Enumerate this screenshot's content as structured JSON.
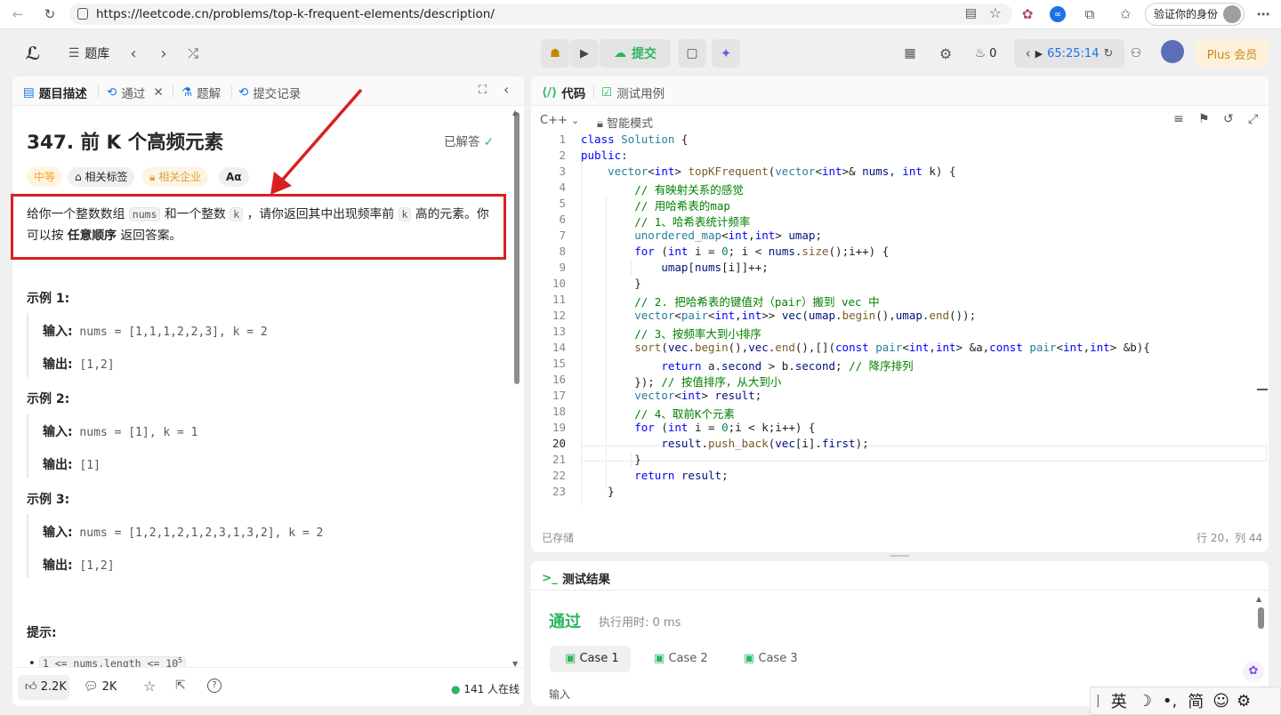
{
  "browser": {
    "url": "https://leetcode.cn/problems/top-k-frequent-elements/description/",
    "profile_label": "验证你的身份"
  },
  "appbar": {
    "problem_list_label": "题库",
    "submit_label": "提交",
    "fire_count": "0",
    "timer": "65:25:14",
    "plus_label": "Plus 会员"
  },
  "left_tabs": {
    "description": "题目描述",
    "accepted": "通过",
    "solutions": "题解",
    "submissions": "提交记录"
  },
  "problem": {
    "title": "347. 前 K 个高频元素",
    "solved_label": "已解答",
    "tags": {
      "difficulty": "中等",
      "related_tags": "相关标签",
      "companies": "相关企业",
      "lang": "Aα"
    },
    "desc_part1": "给你一个整数数组 ",
    "desc_code1": "nums",
    "desc_part2": " 和一个整数 ",
    "desc_code2": "k",
    "desc_part3": " ，请你返回其中出现频率前 ",
    "desc_code3": "k",
    "desc_part4": " 高的元素。你可以按 ",
    "desc_bold": "任意顺序",
    "desc_part5": " 返回答案。",
    "examples": [
      {
        "heading": "示例 1:",
        "input_label": "输入:",
        "input": " nums = [1,1,1,2,2,3], k = 2",
        "output_label": "输出:",
        "output": " [1,2]"
      },
      {
        "heading": "示例 2:",
        "input_label": "输入:",
        "input": " nums = [1], k = 1",
        "output_label": "输出:",
        "output": " [1]"
      },
      {
        "heading": "示例 3:",
        "input_label": "输入:",
        "input": " nums = [1,2,1,2,1,2,3,1,3,2], k = 2",
        "output_label": "输出:",
        "output": " [1,2]"
      }
    ],
    "hints_heading": "提示:",
    "constraint": "1 <= nums.length <= 10",
    "constraint_sup": "5"
  },
  "left_footer": {
    "likes": "2.2K",
    "comments": "2K",
    "online": "141 人在线"
  },
  "code_panel": {
    "tab_code": "代码",
    "tab_testcase": "测试用例",
    "language": "C++",
    "mode": "智能模式",
    "saved": "已存储",
    "cursor": "行 20，列 44",
    "lines": [
      "class Solution {",
      "public:",
      "    vector<int> topKFrequent(vector<int>& nums, int k) {",
      "        // 有映射关系的感觉",
      "        // 用哈希表的map",
      "        // 1、哈希表统计频率",
      "        unordered_map<int,int> umap;",
      "        for (int i = 0; i < nums.size();i++) {",
      "            umap[nums[i]]++;",
      "        }",
      "        // 2. 把哈希表的键值对（pair）搬到 vec 中",
      "        vector<pair<int,int>> vec(umap.begin(),umap.end());",
      "        // 3、按频率大到小排序",
      "        sort(vec.begin(),vec.end(),[](const pair<int,int> &a,const pair<int,int> &b){",
      "            return a.second > b.second; // 降序排列",
      "        }); // 按值排序，从大到小",
      "        vector<int> result;",
      "        // 4、取前K个元素",
      "        for (int i = 0;i < k;i++) {",
      "            result.push_back(vec[i].first);",
      "        }",
      "        return result;",
      "    }"
    ]
  },
  "result_panel": {
    "title": "测试结果",
    "status": "通过",
    "runtime": "执行用时: 0 ms",
    "cases": [
      "Case 1",
      "Case 2",
      "Case 3"
    ],
    "input_label": "输入"
  },
  "ime": {
    "lang": "英",
    "mode": "简"
  },
  "colors": {
    "accent_green": "#2db55d",
    "annotation_red": "#d9201e",
    "plus_bg": "#fdf1dc"
  }
}
